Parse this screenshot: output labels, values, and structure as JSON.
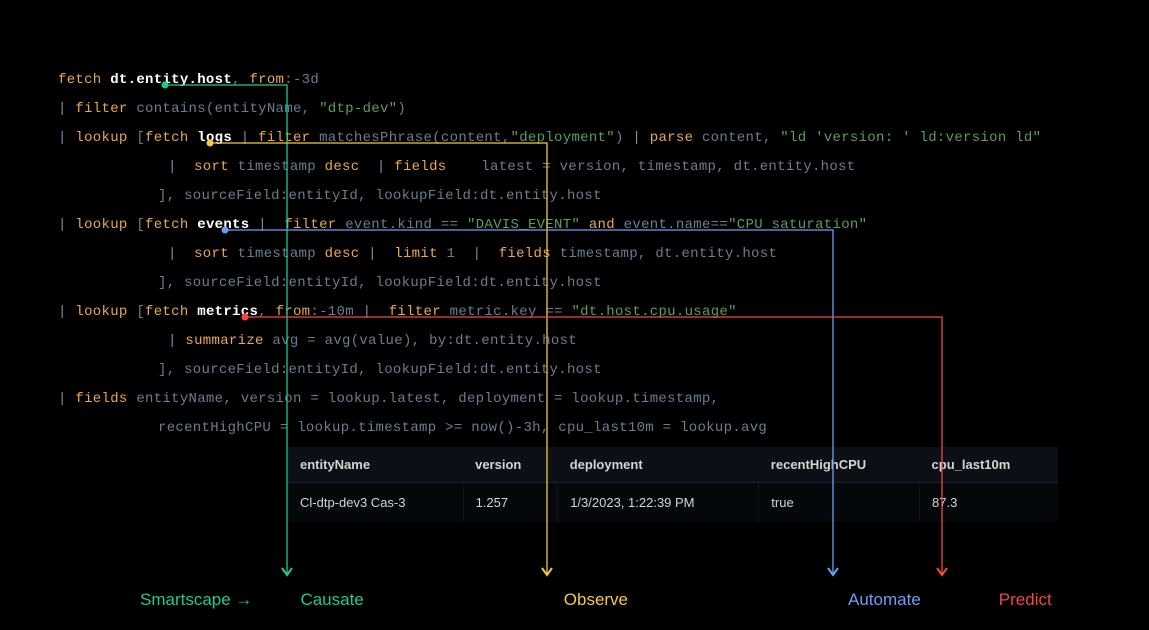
{
  "code": {
    "l1_fetch": "fetch",
    "l1_target": "dt.entity.host",
    "l1_from": "from",
    "l1_from_val": ":-3d",
    "l2_filter": "filter",
    "l2_func": " contains(entityName, ",
    "l2_str": "\"dtp-dev\"",
    "l2_close": ")",
    "l3_lookup": "lookup",
    "l3_open": " [",
    "l3_fetch": "fetch ",
    "l3_logs": "logs",
    "l3_filter": "filter",
    "l3_match": " matchesPhrase(content,",
    "l3_str": "\"deployment\"",
    "l3_close": ")",
    "l3_parse": "parse",
    "l3_content": " content, ",
    "l3_parse_str": "\"ld 'version: ' ld:version ld\"",
    "l4_sort": " sort",
    "l4_ts": " timestamp ",
    "l4_desc": "desc",
    "l4_fields": "fields",
    "l4_rest": "    latest = version, timestamp, dt.entity.host",
    "l5_rest": "], sourceField:entityId, lookupField:dt.entity.host",
    "l6_lookup": "lookup",
    "l6_open": " [",
    "l6_fetch": "fetch ",
    "l6_events": "events",
    "l6_filter": " filter",
    "l6_cond": " event.kind == ",
    "l6_str1": "\"DAVIS_EVENT\"",
    "l6_and": " and ",
    "l6_cond2": "event.name==",
    "l6_str2": "\"CPU saturation\"",
    "l7_sort": " sort",
    "l7_ts": " timestamp ",
    "l7_desc": "desc",
    "l7_limit": " limit",
    "l7_one": " 1  ",
    "l7_fields": " fields",
    "l7_rest": " timestamp, dt.entity.host",
    "l8_rest": "], sourceField:entityId, lookupField:dt.entity.host",
    "l9_lookup": "lookup",
    "l9_open": " [",
    "l9_fetch": "fetch ",
    "l9_metrics": "metrics",
    "l9_from": "from",
    "l9_from_val": ":-10m",
    "l9_filter": " filter",
    "l9_cond": " metric.key == ",
    "l9_str": "\"dt.host.cpu.usage\"",
    "l10_summarize": "summarize",
    "l10_rest": " avg = avg(value), by:dt.entity.host",
    "l11_rest": "], sourceField:entityId, lookupField:dt.entity.host",
    "l12_fields": "fields",
    "l12_rest": " entityName, version = lookup.latest, deployment = lookup.timestamp,",
    "l13_rest": "recentHighCPU = lookup.timestamp >= now()-3h, cpu_last10m = lookup.avg"
  },
  "table": {
    "headers": [
      "entityName",
      "version",
      "deployment",
      "recentHighCPU",
      "cpu_last10m"
    ],
    "row": [
      "Cl-dtp-dev3 Cas-3",
      "1.257",
      "1/3/2023, 1:22:39 PM",
      "true",
      "87.3"
    ]
  },
  "footer": {
    "smartscape": "Smartscape →",
    "causate": "Causate",
    "observe": "Observe",
    "automate": "Automate",
    "predict": "Predict"
  },
  "colors": {
    "green": "#1dcb8a",
    "yellow": "#f5c842",
    "blue": "#6b9ef5",
    "red": "#f54545"
  }
}
